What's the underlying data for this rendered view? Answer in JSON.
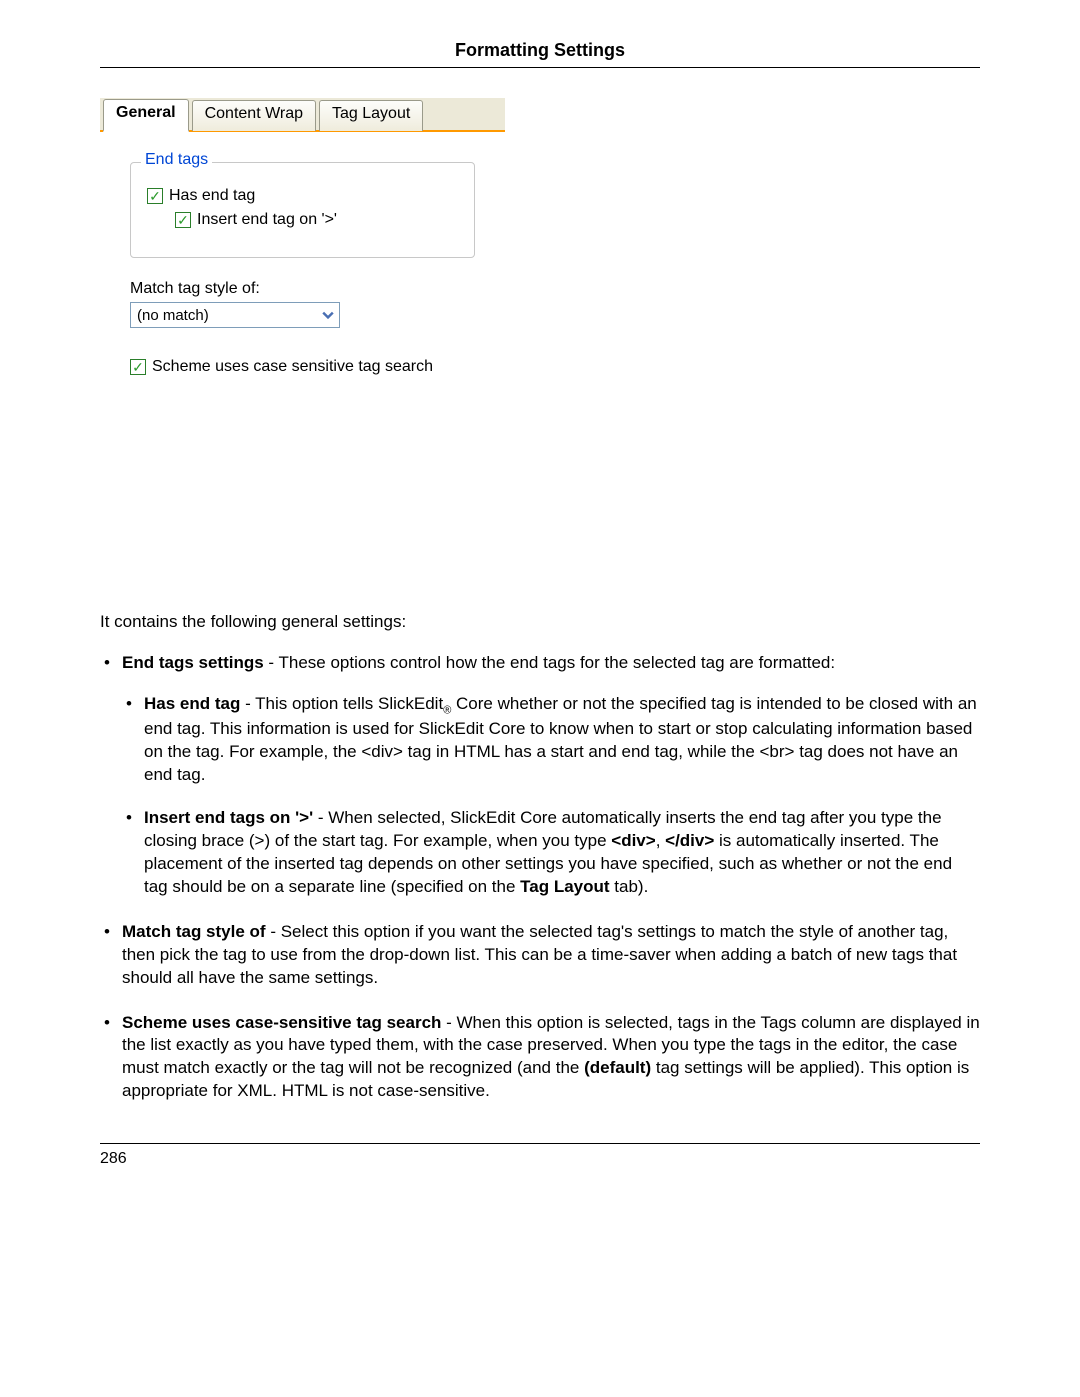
{
  "header": {
    "title": "Formatting Settings"
  },
  "footer": {
    "page_number": "286"
  },
  "dialog": {
    "tabs": [
      {
        "label": "General",
        "active": true
      },
      {
        "label": "Content Wrap",
        "active": false
      },
      {
        "label": "Tag Layout",
        "active": false
      }
    ],
    "groupbox_label": "End tags",
    "cb_has_end_tag": {
      "label": "Has end tag",
      "checked": true
    },
    "cb_insert_end_tag": {
      "label": "Insert end tag on '>'",
      "checked": true
    },
    "match_label": "Match tag style of:",
    "match_value": "(no match)",
    "cb_case_sensitive": {
      "label": "Scheme uses case sensitive tag search",
      "checked": true
    }
  },
  "body": {
    "intro": "It contains the following general settings:",
    "end_tags_lead_bold": "End tags settings",
    "end_tags_lead_rest": " - These options control how the end tags for the selected tag are formatted:",
    "has_end_tag_bold": "Has end tag",
    "has_end_tag_rest_1": " - This option tells SlickEdit",
    "has_end_tag_reg": "®",
    "has_end_tag_rest_2": " Core whether or not the specified tag is intended to be closed with an end tag. This information is used for SlickEdit Core to know when to start or stop calculating information based on the tag. For example, the <div> tag in HTML has a start and end tag, while the <br> tag does not have an end tag.",
    "insert_bold": "Insert end tags on '>'",
    "insert_rest_1": " - When selected, SlickEdit Core automatically inserts the end tag after you type the closing brace (>) of the start tag. For example, when you type ",
    "insert_div_open": "<div>",
    "insert_comma": ", ",
    "insert_div_close": "</div>",
    "insert_rest_2": " is automatically inserted. The placement of the inserted tag depends on other settings you have specified, such as whether or not the end tag should be on a separate line (specified on the ",
    "insert_taglayout": "Tag Layout",
    "insert_rest_3": " tab).",
    "match_bold": "Match tag style of",
    "match_rest": " - Select this option if you want the selected tag's settings to match the style of another tag, then pick the tag to use from the drop-down list. This can be a time-saver when adding a batch of new tags that should all have the same settings.",
    "scheme_bold": "Scheme uses case-sensitive tag search",
    "scheme_rest_1": " - When this option is selected, tags in the Tags column are displayed in the list exactly as you have typed them, with the case preserved. When you type the tags in the editor, the case must match exactly or the tag will not be recognized (and the ",
    "scheme_default": "(default)",
    "scheme_rest_2": " tag settings will be applied). This option is appropriate for XML. HTML is not case-sensitive."
  }
}
